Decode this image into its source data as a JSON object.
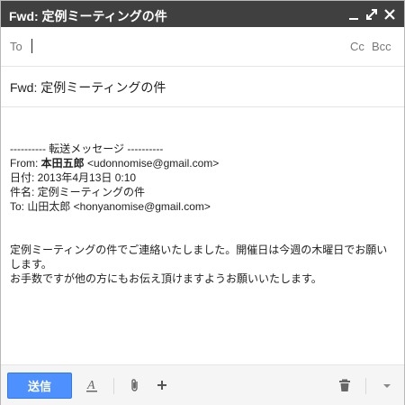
{
  "window": {
    "title": "Fwd: 定例ミーティングの件"
  },
  "to_row": {
    "label": "To",
    "value": "",
    "cc_label": "Cc",
    "bcc_label": "Bcc"
  },
  "subject": {
    "value": "Fwd: 定例ミーティングの件"
  },
  "forwarded": {
    "separator": "---------- 転送メッセージ ----------",
    "from_prefix": "From: ",
    "from_name": "本田五郎",
    "from_email": " <udonnomise@gmail.com>",
    "date_line": "日付: 2013年4月13日 0:10",
    "subject_line": "件名: 定例ミーティングの件",
    "to_line": "To: 山田太郎 <honyanomise@gmail.com>"
  },
  "message": {
    "line1": "定例ミーティングの件でご連絡いたしました。開催日は今週の木曜日でお願いします。",
    "line2": "お手数ですが他の方にもお伝え頂けますようお願いいたします。"
  },
  "toolbar": {
    "send_label": "送信"
  },
  "icons": {
    "minimize": "minimize-icon",
    "popout": "popout-icon",
    "close": "close-icon",
    "format": "text-format-icon",
    "attach": "paperclip-icon",
    "insert": "plus-icon",
    "trash": "trash-icon",
    "more": "chevron-down-icon"
  },
  "colors": {
    "titlebar": "#404040",
    "send_button": "#4d90fe",
    "muted_text": "#777777"
  }
}
